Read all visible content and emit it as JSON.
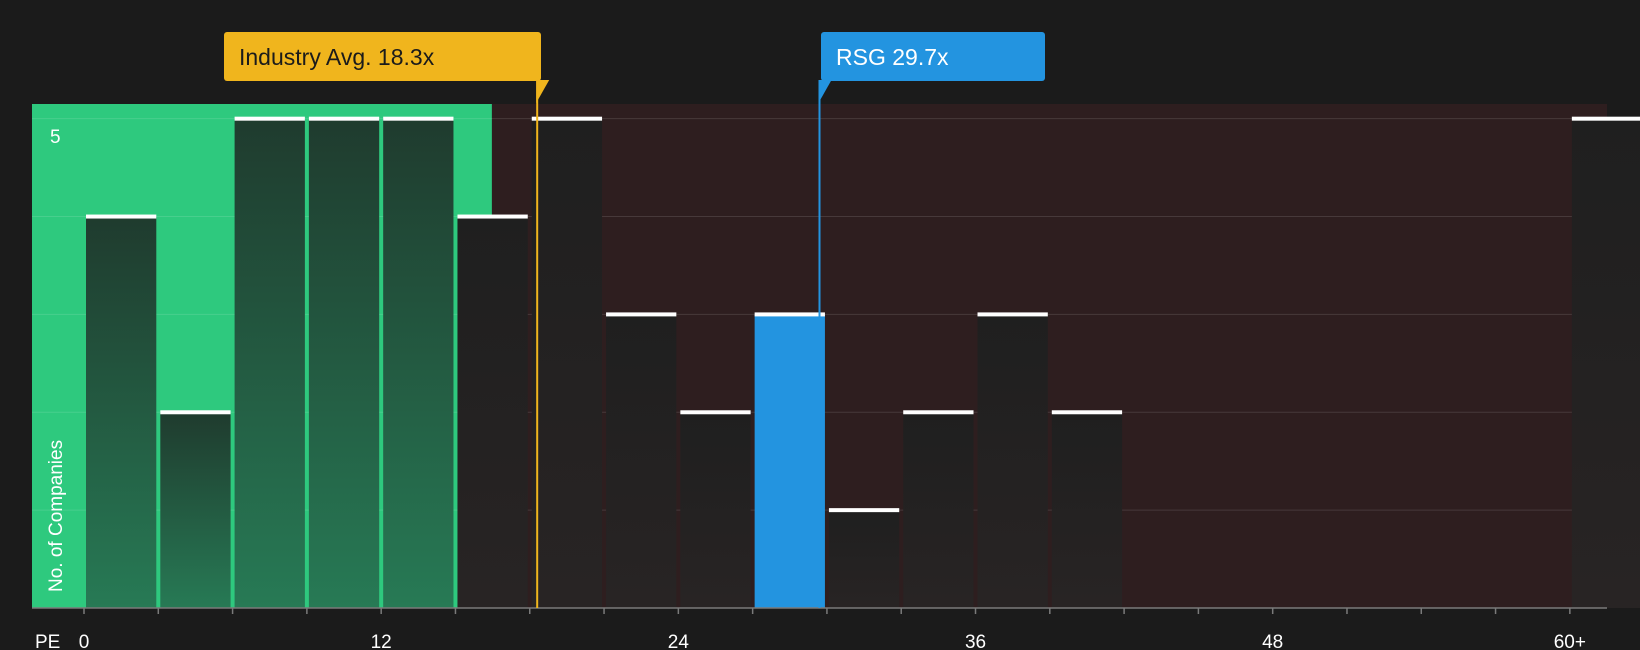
{
  "chart_data": {
    "type": "bar",
    "xlabel": "PE",
    "ylabel": "No. of Companies",
    "x_ticks": [
      "0",
      "12",
      "24",
      "36",
      "48",
      "60+"
    ],
    "y_ticks": [
      "5"
    ],
    "bin_width": 3,
    "bins": [
      {
        "start": 0,
        "count": 4
      },
      {
        "start": 3,
        "count": 2
      },
      {
        "start": 6,
        "count": 5
      },
      {
        "start": 9,
        "count": 5
      },
      {
        "start": 12,
        "count": 5
      },
      {
        "start": 15,
        "count": 4
      },
      {
        "start": 18,
        "count": 5
      },
      {
        "start": 21,
        "count": 3
      },
      {
        "start": 24,
        "count": 2
      },
      {
        "start": 27,
        "count": 3
      },
      {
        "start": 30,
        "count": 1
      },
      {
        "start": 33,
        "count": 2
      },
      {
        "start": 36,
        "count": 3
      },
      {
        "start": 39,
        "count": 2
      },
      {
        "start": 60,
        "count": 5
      }
    ],
    "ylim": [
      0,
      5.15
    ],
    "xlim": [
      -2.1,
      61.5
    ],
    "industry_avg": {
      "label": "Industry Avg. 18.3x",
      "value": 18.3
    },
    "company": {
      "label": "RSG 29.7x",
      "value": 29.7,
      "bin_start": 27
    },
    "grid": true,
    "colors": {
      "undervalued_zone": "#2ec97e",
      "overvalued_zone": "#2e1e1f",
      "industry": "#f0b51d",
      "company": "#2394e0",
      "bar_top": "#ffffff"
    }
  }
}
